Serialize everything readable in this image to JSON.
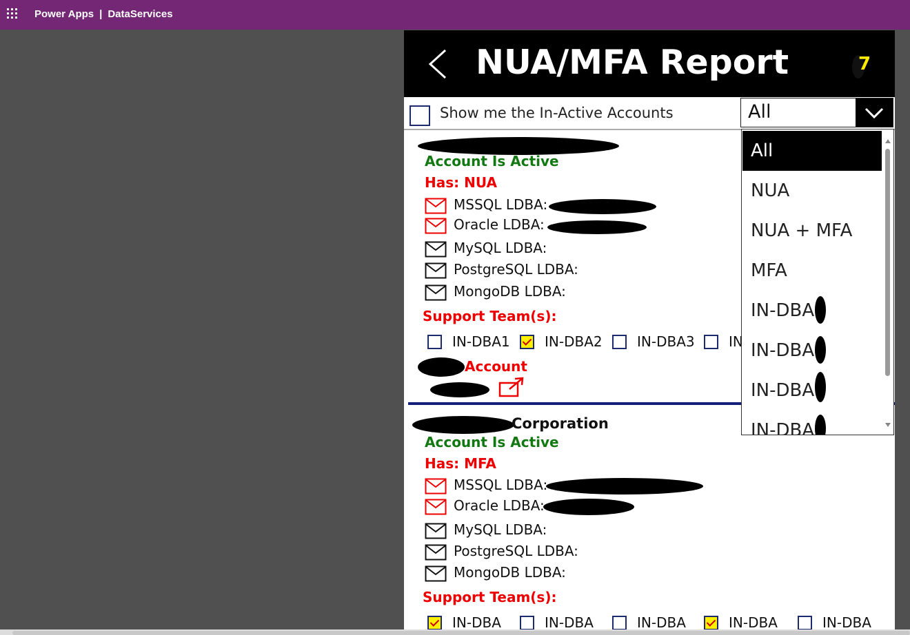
{
  "topbar": {
    "app_name": "Power Apps",
    "separator": "|",
    "env_name": "DataServices"
  },
  "header": {
    "title": "NUA/MFA Report",
    "count": "7"
  },
  "filter": {
    "inactive_label": "Show me the In-Active Accounts",
    "inactive_checked": false,
    "combo_value": "All",
    "options": [
      "All",
      "NUA",
      "NUA + MFA",
      "MFA",
      "IN-DBA",
      "IN-DBA",
      "IN-DBA",
      "IN-DBA"
    ],
    "selected_option": "All"
  },
  "cards": [
    {
      "name_suffix": "",
      "status": "Account Is Active",
      "has": "Has: NUA",
      "ldba": [
        {
          "label": "MSSQL LDBA:",
          "color": "red"
        },
        {
          "label": "Oracle LDBA:",
          "color": "red"
        },
        {
          "label": "MySQL LDBA:",
          "color": "black"
        },
        {
          "label": "PostgreSQL LDBA:",
          "color": "black"
        },
        {
          "label": "MongoDB LDBA:",
          "color": "black"
        }
      ],
      "support_label": "Support Team(s):",
      "teams": [
        {
          "label": "IN-DBA1",
          "checked": false
        },
        {
          "label": "IN-DBA2",
          "checked": true
        },
        {
          "label": "IN-DBA3",
          "checked": false
        },
        {
          "label": "IN",
          "checked": false
        }
      ],
      "account_link": "Account"
    },
    {
      "name_suffix": "Corporation",
      "status": "Account Is Active",
      "has": "Has: MFA",
      "ldba": [
        {
          "label": "MSSQL LDBA:",
          "color": "red"
        },
        {
          "label": "Oracle LDBA:",
          "color": "red"
        },
        {
          "label": "MySQL LDBA:",
          "color": "black"
        },
        {
          "label": "PostgreSQL LDBA:",
          "color": "black"
        },
        {
          "label": "MongoDB LDBA:",
          "color": "black"
        }
      ],
      "support_label": "Support Team(s):",
      "teams": [
        {
          "label": "IN-DBA",
          "checked": true
        },
        {
          "label": "IN-DBA",
          "checked": false
        },
        {
          "label": "IN-DBA",
          "checked": false
        },
        {
          "label": "IN-DBA",
          "checked": true
        },
        {
          "label": "IN-DBA",
          "checked": false
        }
      ]
    }
  ],
  "colors": {
    "brand": "#742774",
    "active": "#127812",
    "alert": "#ee0000",
    "count": "#ffea00",
    "divider": "#14207a"
  }
}
